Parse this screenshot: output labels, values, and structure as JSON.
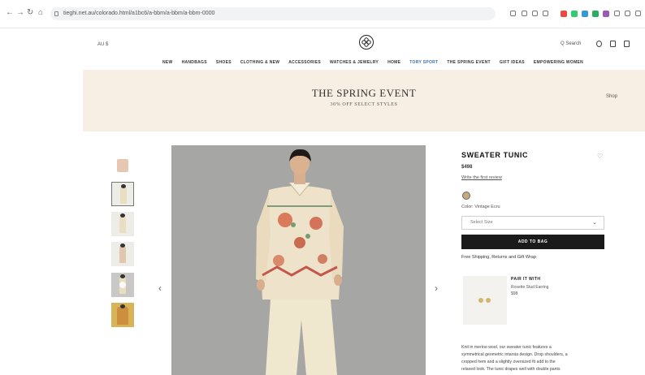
{
  "browser": {
    "url": "tieghi.net.au/colorado.html/a1bc6/a-bbm/a-bbm/a-bbm-0000",
    "extension_colors": [
      "#e74c3c",
      "#2ecc71",
      "#3498db",
      "#27ae60",
      "#9b59b6"
    ]
  },
  "header": {
    "locale": "AU $",
    "search_label": "Q Search"
  },
  "nav": {
    "items": [
      "NEW",
      "HANDBAGS",
      "SHOES",
      "CLOTHING & NEW",
      "ACCESSORIES",
      "WATCHES & JEWELRY",
      "HOME",
      "TORY SPORT",
      "THE SPRING EVENT",
      "GIFT IDEAS",
      "EMPOWERING WOMEN"
    ],
    "active_index": 7,
    "active_color": "#3a6ea5"
  },
  "banner": {
    "title": "THE SPRING EVENT",
    "subtitle": "30% OFF SELECT STYLES",
    "shop_link": "Shop"
  },
  "product": {
    "name": "SWEATER TUNIC",
    "price": "$498",
    "review_link": "Write the first review",
    "color_line": "Color: Vintage Ecru",
    "size_placeholder": "Select Size",
    "add_to_bag": "ADD TO BAG",
    "shipping_line": "Free Shipping, Returns and Gift Wrap",
    "pair": {
      "heading": "PAIR IT WITH",
      "name": "Rosette Stud Earring",
      "price": "$98"
    },
    "description": [
      "Knit in merino wool, our sweater tunic features a",
      "symmetrical geometric intarsia design. Drop shoulders, a",
      "cropped hem and a slightly oversized fit add to the",
      "relaxed look. The tunic drapes well with double pants"
    ]
  }
}
